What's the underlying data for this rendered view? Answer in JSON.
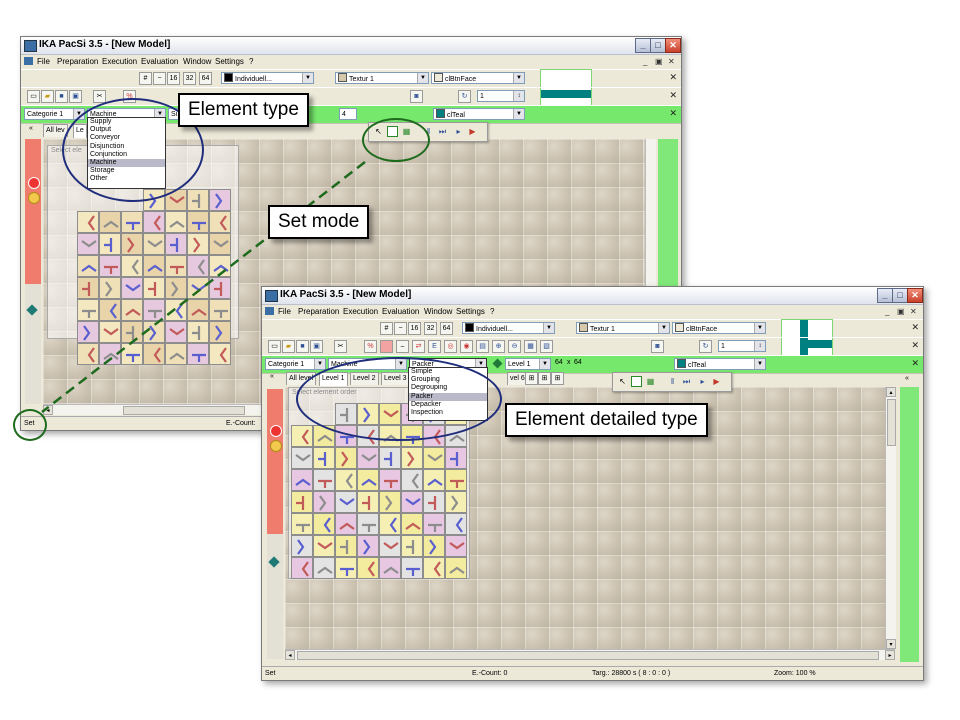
{
  "window1": {
    "title": "IKA PacSi 3.5 - [New Model]",
    "menu": [
      "File",
      "Preparation",
      "Execution",
      "Evaluation",
      "Window",
      "Settings",
      "?"
    ],
    "toolbar1": {
      "zoom_labels": [
        "16",
        "32",
        "64"
      ],
      "color_select": "Individuell...",
      "texture_select": "Textur 1",
      "face_select": "clBtnFace"
    },
    "toolbar2": {
      "spin_value": "1"
    },
    "toolbar3": {
      "category_select": "Categorie 1",
      "type_select": "Machine",
      "detail_select": "Si",
      "size_label": "4",
      "teal_select": "clTeal"
    },
    "tabs": [
      "All lev",
      "Le"
    ],
    "type_options": [
      "Supply",
      "Output",
      "Conveyor",
      "Disjunction",
      "Conjunction",
      "Machine",
      "Storage",
      "Other"
    ],
    "type_selected": "Machine",
    "selbox_caption": "Select ele",
    "status_mode": "Set",
    "status_count": "E.-Count:"
  },
  "window2": {
    "title": "IKA PacSi 3.5 - [New Model]",
    "menu": [
      "File",
      "Preparation",
      "Execution",
      "Evaluation",
      "Window",
      "Settings",
      "?"
    ],
    "toolbar1": {
      "zoom_labels": [
        "16",
        "32",
        "64"
      ],
      "color_select": "Individuell...",
      "texture_select": "Textur 1",
      "face_select": "clBtnFace"
    },
    "toolbar2": {
      "spin_value": "1"
    },
    "toolbar3": {
      "category_select": "Categorie 1",
      "type_select": "Machine",
      "detail_select": "Packer",
      "level_select": "Level 1",
      "size_a": "64",
      "size_x": "x",
      "size_b": "64",
      "teal_select": "clTeal"
    },
    "tabs": [
      "All level",
      "Level 1",
      "Level 2",
      "Level 3",
      "vel 6"
    ],
    "detail_options": [
      "Simple",
      "Grouping",
      "Degrouping",
      "Packer",
      "Depacker",
      "Inspection"
    ],
    "detail_selected": "Packer",
    "selbox_caption": "Select element order",
    "status_mode": "Set",
    "status_count": "E.-Count: 0",
    "status_target": "Targ.: 28800  s    ( 8 : 0 : 0 )",
    "status_zoom": "Zoom: 100 %"
  },
  "callouts": {
    "element_type": "Element type",
    "set_mode": "Set  mode",
    "element_detailed_type": "Element detailed type"
  },
  "colors": {
    "green_toolbar": "#76e86c",
    "red_bar": "#f07c6e",
    "teal": "#008080",
    "annotation_blue": "#1f2d7c",
    "annotation_green": "#1e6b1e"
  }
}
